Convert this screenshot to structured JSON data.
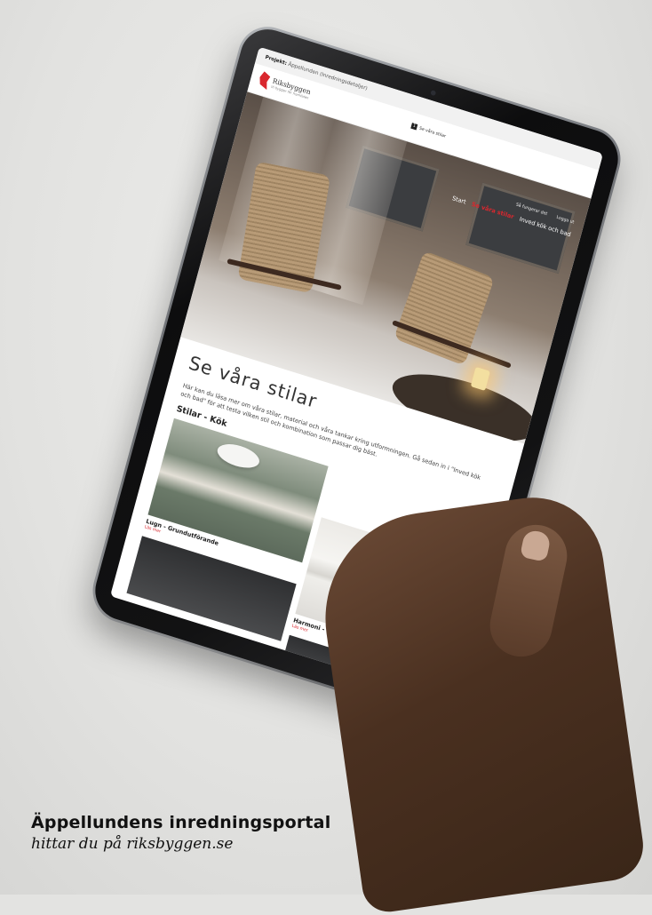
{
  "screen": {
    "topbar": {
      "project_label": "Projekt:",
      "project_value": "Äppellunden (Inredningsdetaljer)"
    },
    "header": {
      "logo_text": "Riksbyggen",
      "logo_sub": "Vi bygger för framtiden",
      "chip_label": "Se våra stilar",
      "chip_icon": "1"
    },
    "nav": {
      "top_links": [
        "Så fungerar det",
        "Logga ut"
      ],
      "links": [
        "Start",
        "Se våra stilar",
        "Inved kök och bad"
      ],
      "active_index": 1
    },
    "content": {
      "heading": "Se våra stilar",
      "intro": "Här kan du läsa mer om våra stilar, material och våra tankar kring utformningen. Gå sedan in i \"Inved kök och bad\" för att testa vilken stil och kombination som passar dig bäst.",
      "section_title": "Stilar - Kök",
      "cards": [
        {
          "title": "Lugn - Grundutförande",
          "link": "Läs mer"
        },
        {
          "title": "Harmoni - Fritt val",
          "link": "Läs mer"
        }
      ]
    }
  },
  "caption": {
    "title": "Äppellundens inredningsportal",
    "subtitle": "hittar du på riksbyggen.se"
  },
  "colors": {
    "brand_red": "#d9272e",
    "background": "#e3e3e1"
  }
}
